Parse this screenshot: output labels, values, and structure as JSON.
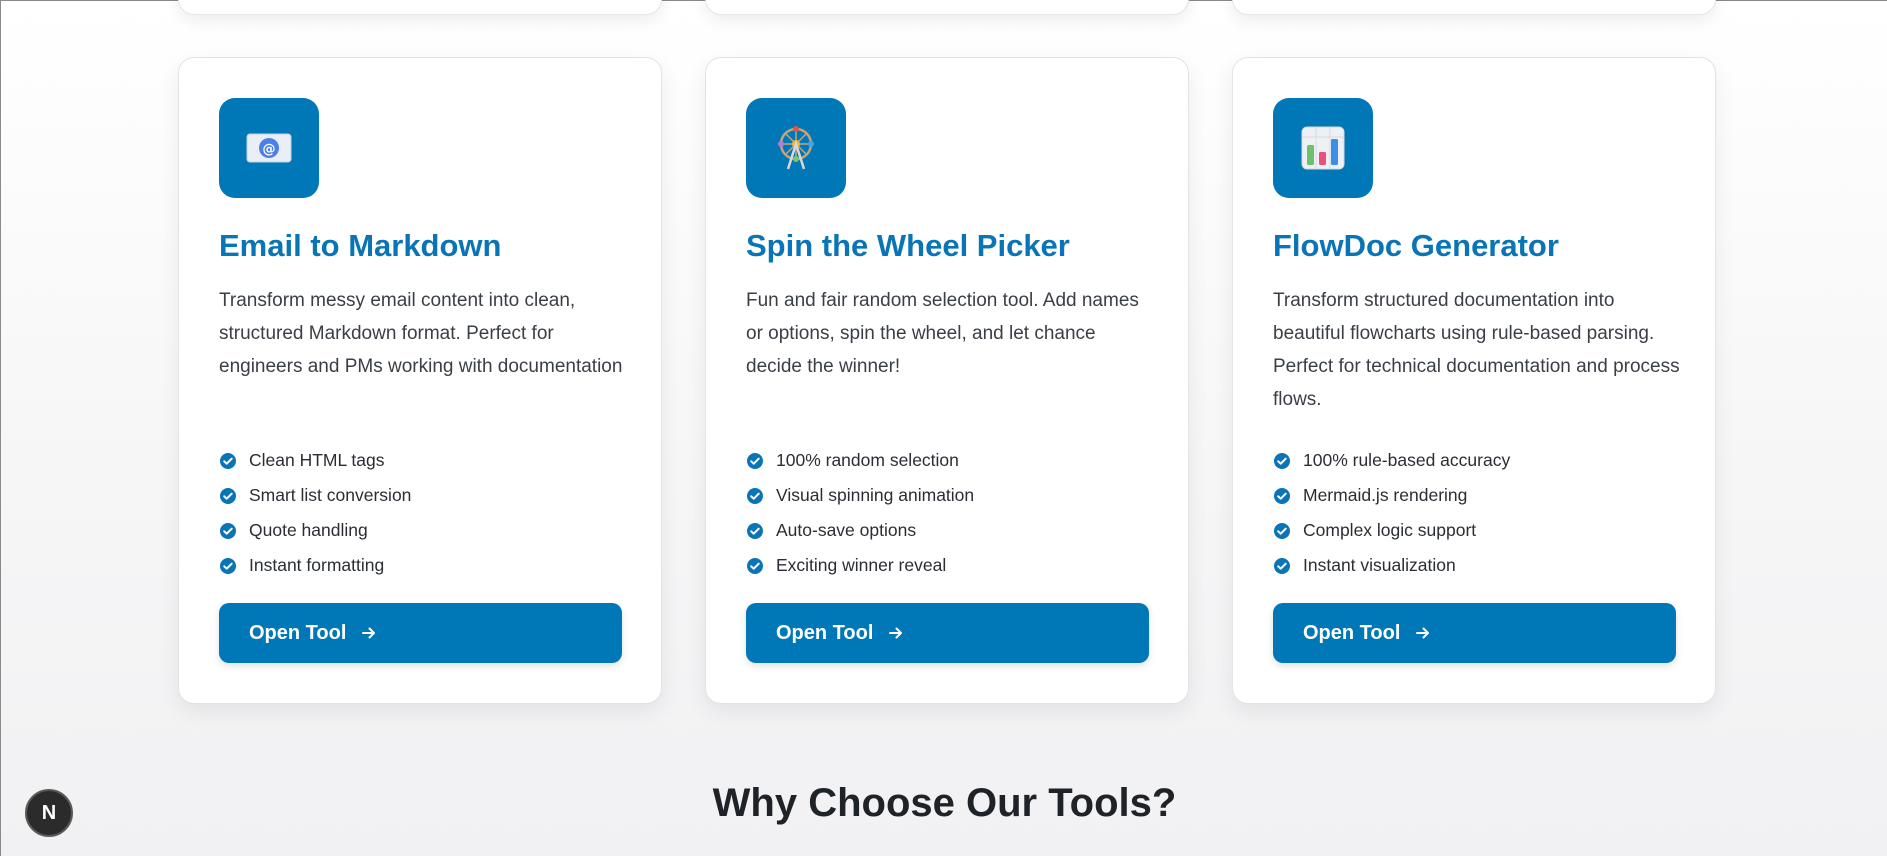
{
  "cards": [
    {
      "icon": "email-icon",
      "title": "Email to Markdown",
      "description": "Transform messy email content into clean, structured Markdown format. Perfect for engineers and PMs working with documentation",
      "features": [
        "Clean HTML tags",
        "Smart list conversion",
        "Quote handling",
        "Instant formatting"
      ],
      "button": "Open Tool"
    },
    {
      "icon": "ferris-wheel-icon",
      "title": "Spin the Wheel Picker",
      "description": "Fun and fair random selection tool. Add names or options, spin the wheel, and let chance decide the winner!",
      "features": [
        "100% random selection",
        "Visual spinning animation",
        "Auto-save options",
        "Exciting winner reveal"
      ],
      "button": "Open Tool"
    },
    {
      "icon": "bar-chart-icon",
      "title": "FlowDoc Generator",
      "description": "Transform structured documentation into beautiful flowcharts using rule-based parsing. Perfect for technical documentation and process flows.",
      "features": [
        "100% rule-based accuracy",
        "Mermaid.js rendering",
        "Complex logic support",
        "Instant visualization"
      ],
      "button": "Open Tool"
    }
  ],
  "section": {
    "heading": "Why Choose Our Tools?"
  },
  "dev_badge": {
    "label": "N"
  },
  "colors": {
    "accent": "#0077b6",
    "title": "#0a75b6"
  }
}
